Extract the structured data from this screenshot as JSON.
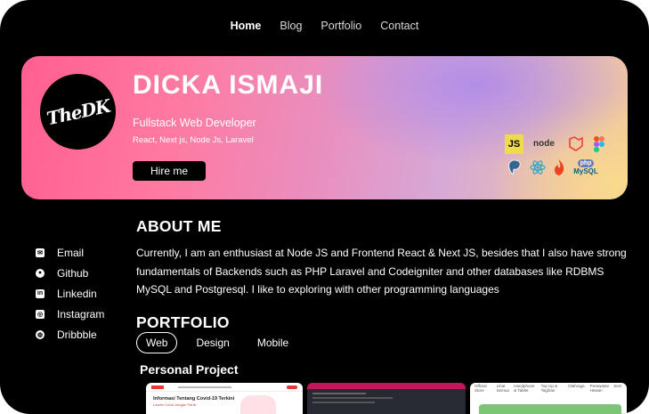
{
  "nav": {
    "home": "Home",
    "blog": "Blog",
    "portfolio": "Portfolio",
    "contact": "Contact"
  },
  "hero": {
    "logo_text": "TheDK",
    "name": "DICKA ISMAJI",
    "role": "Fullstack Web Developer",
    "stack": "React, Next js, Node Js, Laravel",
    "hire_label": "Hire me",
    "tech_icons": [
      "js-icon",
      "nodejs-icon",
      "laravel-icon",
      "figma-icon",
      "postgresql-icon",
      "react-icon",
      "codeigniter-icon",
      "php-mysql-icon"
    ]
  },
  "social": {
    "email": "Email",
    "github": "Github",
    "linkedin": "Linkedin",
    "instagram": "Instagram",
    "dribbble": "Dribbble"
  },
  "about": {
    "heading": "ABOUT ME",
    "text": "Currently, I am an enthusiast at Node JS and Frontend React & Next JS, besides that I also have strong fundamentals of Backends such as PHP Laravel and Codeigniter and other databases like RDBMS MySQL and Postgresql. I like to exploring with other programming languages"
  },
  "portfolio": {
    "heading": "PORTFOLIO",
    "tabs": [
      "Web",
      "Design",
      "Mobile"
    ],
    "section": "Personal Project",
    "card1_title": "Informasi Tentang Covid-19 Terkini",
    "card1_sub": "Lawan Covid Jangan Panik",
    "card3_menu": [
      "Official Store",
      "Lihat Semua",
      "Handphone & Tablet",
      "Top Up & Tagihan",
      "Olahraga",
      "Perawatan Hewan",
      "Sem"
    ]
  },
  "colors": {
    "background": "#000000",
    "hero_pink": "#ff5f8f",
    "hero_purple": "#b08ce8",
    "hero_yellow": "#f8da8c"
  }
}
